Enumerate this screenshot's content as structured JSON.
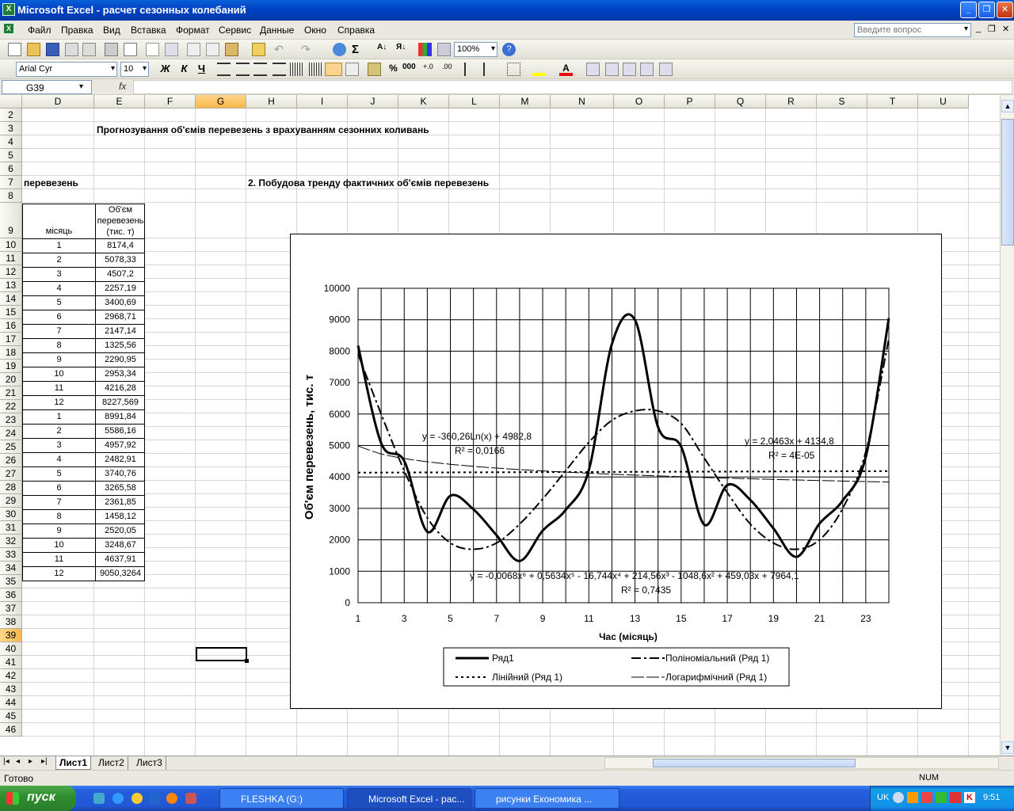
{
  "window": {
    "title": "Microsoft Excel - расчет сезонных колебаний"
  },
  "menu": [
    "Файл",
    "Правка",
    "Вид",
    "Вставка",
    "Формат",
    "Сервис",
    "Данные",
    "Окно",
    "Справка"
  ],
  "help_placeholder": "Введите вопрос",
  "toolbar": {
    "zoom": "100%",
    "font": "Arial Cyr",
    "size": "10",
    "bold": "Ж",
    "italic": "К",
    "underline": "Ч",
    "percent": "%",
    "thousands": "000"
  },
  "formula": {
    "cell": "G39",
    "fx": "fx",
    "content": ""
  },
  "columns": [
    "D",
    "E",
    "F",
    "G",
    "H",
    "I",
    "J",
    "K",
    "L",
    "M",
    "N",
    "O",
    "P",
    "Q",
    "R",
    "S",
    "T",
    "U"
  ],
  "rows": [
    "2",
    "3",
    "4",
    "5",
    "6",
    "7",
    "8",
    "9",
    "10",
    "11",
    "12",
    "13",
    "14",
    "15",
    "16",
    "17",
    "18",
    "19",
    "20",
    "21",
    "22",
    "23",
    "24",
    "25",
    "26",
    "27",
    "28",
    "29",
    "30",
    "31",
    "32",
    "33",
    "34",
    "35",
    "36",
    "37",
    "38",
    "39",
    "40",
    "41",
    "42",
    "43",
    "44",
    "45",
    "46"
  ],
  "sheet": {
    "title": "Прогнозування об'ємів перевезень з врахуванням сезонних коливань",
    "d7": "перевезень",
    "h7": "2. Побудова тренду фактичних об'ємів перевезень",
    "hdr_month": "місяць",
    "hdr_volume": [
      "Об'єм",
      "перевезень",
      "(тис. т)"
    ],
    "table": [
      [
        "1",
        "8174,4"
      ],
      [
        "2",
        "5078,33"
      ],
      [
        "3",
        "4507,2"
      ],
      [
        "4",
        "2257,19"
      ],
      [
        "5",
        "3400,69"
      ],
      [
        "6",
        "2968,71"
      ],
      [
        "7",
        "2147,14"
      ],
      [
        "8",
        "1325,56"
      ],
      [
        "9",
        "2290,95"
      ],
      [
        "10",
        "2953,34"
      ],
      [
        "11",
        "4216,28"
      ],
      [
        "12",
        "8227,569"
      ],
      [
        "1",
        "8991,84"
      ],
      [
        "2",
        "5586,16"
      ],
      [
        "3",
        "4957,92"
      ],
      [
        "4",
        "2482,91"
      ],
      [
        "5",
        "3740,76"
      ],
      [
        "6",
        "3265,58"
      ],
      [
        "7",
        "2361,85"
      ],
      [
        "8",
        "1458,12"
      ],
      [
        "9",
        "2520,05"
      ],
      [
        "10",
        "3248,67"
      ],
      [
        "11",
        "4637,91"
      ],
      [
        "12",
        "9050,3264"
      ]
    ]
  },
  "chart_data": {
    "type": "line",
    "ylabel": "Об'єм перевезень, тис. т",
    "xlabel": "Час (місяць)",
    "ylim": [
      0,
      10000
    ],
    "xlim": [
      1,
      24
    ],
    "yticks": [
      "0",
      "1000",
      "2000",
      "3000",
      "4000",
      "5000",
      "6000",
      "7000",
      "8000",
      "9000",
      "10000"
    ],
    "xticks": [
      "1",
      "3",
      "5",
      "7",
      "9",
      "11",
      "13",
      "15",
      "17",
      "19",
      "21",
      "23"
    ],
    "x": [
      1,
      2,
      3,
      4,
      5,
      6,
      7,
      8,
      9,
      10,
      11,
      12,
      13,
      14,
      15,
      16,
      17,
      18,
      19,
      20,
      21,
      22,
      23,
      24
    ],
    "series": [
      {
        "name": "Ряд1",
        "values": [
          8174.4,
          5078.33,
          4507.2,
          2257.19,
          3400.69,
          2968.71,
          2147.14,
          1325.56,
          2290.95,
          2953.34,
          4216.28,
          8227.569,
          8991.84,
          5586.16,
          4957.92,
          2482.91,
          3740.76,
          3265.58,
          2361.85,
          1458.12,
          2520.05,
          3248.67,
          4637.91,
          9050.3264
        ]
      },
      {
        "name": "Поліноміальний (Ряд 1)",
        "values": [
          7900,
          6000,
          4200,
          2700,
          1900,
          1700,
          1900,
          2500,
          3300,
          4200,
          5100,
          5800,
          6100,
          6100,
          5700,
          4600,
          3500,
          2500,
          1900,
          1700,
          2000,
          3000,
          4800,
          8400
        ]
      },
      {
        "name": "Лінійний (Ряд 1)",
        "values": [
          4136.9,
          4138.9,
          4141.0,
          4143.0,
          4145.1,
          4147.1,
          4149.2,
          4151.2,
          4153.3,
          4155.4,
          4157.4,
          4159.4,
          4161.5,
          4163.6,
          4165.6,
          4167.7,
          4169.7,
          4171.8,
          4173.8,
          4175.9,
          4177.9,
          4180.0,
          4182.0,
          4184.0
        ]
      },
      {
        "name": "Логарифмічний (Ряд 1)",
        "values": [
          4982.8,
          4733.1,
          4587.0,
          4483.4,
          4403.0,
          4337.3,
          4281.8,
          4233.6,
          4191.2,
          4153.2,
          4118.9,
          4087.6,
          4058.7,
          4032.0,
          4007.2,
          3984.0,
          3962.1,
          3941.5,
          3922.0,
          3903.5,
          3885.9,
          3869.2,
          3853.1,
          3837.8
        ]
      }
    ],
    "annotations": {
      "log_eq": "y = -360,26Ln(x) + 4982,8",
      "log_r2": "R² = 0,0166",
      "lin_eq": "y = 2,0463x + 4134,8",
      "lin_r2": "R² = 4E-05",
      "poly_eq": "y = -0,0068x⁶ + 0,5634x⁵ - 16,744x⁴ + 214,56x³ - 1048,6x² + 459,03x + 7964,1",
      "poly_r2": "R² = 0,7435"
    }
  },
  "tabs": [
    "Лист1",
    "Лист2",
    "Лист3"
  ],
  "status": {
    "ready": "Готово",
    "num": "NUM"
  },
  "taskbar": {
    "start": "пуск",
    "tasks": [
      "FLESHKA (G:)",
      "Microsoft Excel - рас...",
      "рисунки Економика ..."
    ],
    "lang": "UK",
    "clock": "9:51"
  }
}
